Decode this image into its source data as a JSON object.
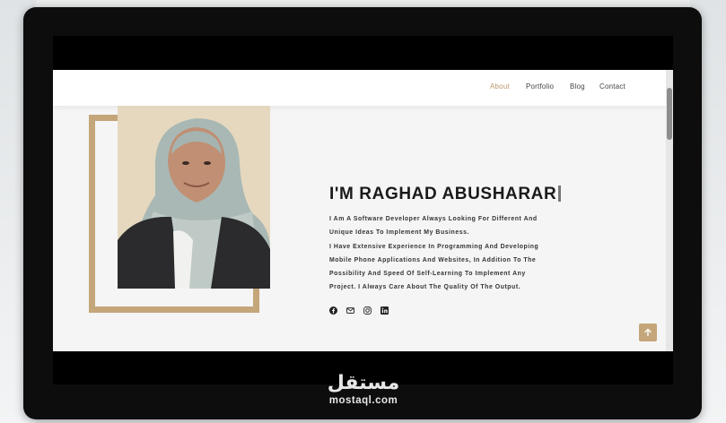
{
  "nav": {
    "items": [
      {
        "label": "About",
        "active": true
      },
      {
        "label": "Portfolio",
        "active": false
      },
      {
        "label": "Blog",
        "active": false
      },
      {
        "label": "Contact",
        "active": false
      }
    ]
  },
  "hero": {
    "title": "I'M RAGHAD ABUSHARAR",
    "bio_lines": [
      "I Am A Software Developer Always Looking For Different And",
      "Unique Ideas To Implement My Business.",
      "I Have Extensive Experience In Programming And Developing",
      "Mobile Phone Applications And Websites, In Addition To The",
      "Possibility And Speed Of Self-Learning To Implement Any",
      "Project. I Always Care About The Quality Of The Output."
    ],
    "socials": [
      "facebook-icon",
      "email-icon",
      "instagram-icon",
      "linkedin-icon"
    ]
  },
  "scroll_top": {
    "icon": "arrow-up-icon"
  },
  "watermark": {
    "arabic": "مستقل",
    "url": "mostaql.com"
  },
  "colors": {
    "accent": "#c4a67a",
    "nav_active": "#b89a6c",
    "title": "#1a1a1a",
    "monitor_bezel": "#0d0d0d",
    "page_bg": "#f5f5f5"
  }
}
